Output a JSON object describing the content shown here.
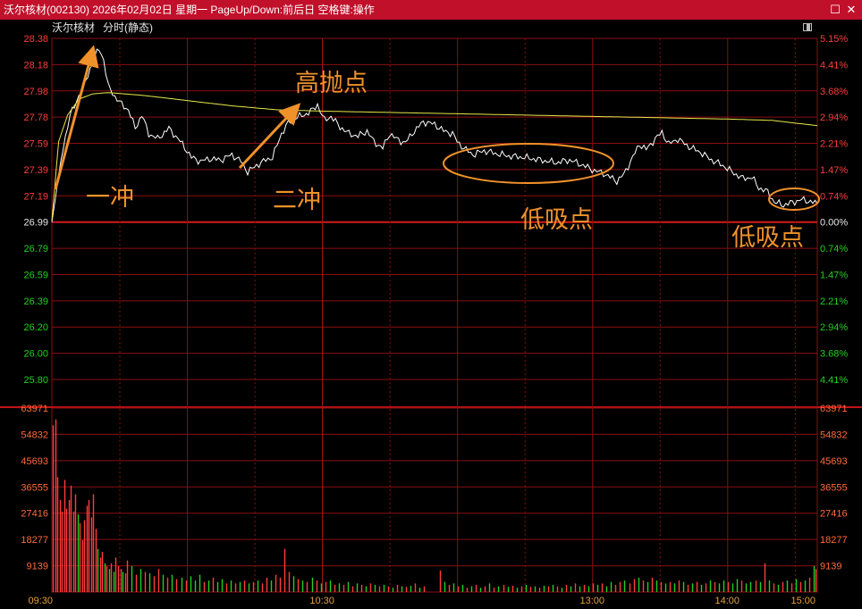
{
  "window": {
    "title": "沃尔核材(002130)  2026年02月02日  星期一  PageUp/Down:前后日  空格键:操作",
    "restore_icon": "restore-icon",
    "close_icon": "close-icon"
  },
  "header": {
    "stock_name": "沃尔核材",
    "chart_mode": "分时(静态)"
  },
  "colors": {
    "up": "#ff3c3c",
    "down": "#20d020",
    "grid": "#8b0f0f",
    "price_line": "#ffffff",
    "avg_line": "#e8e84a",
    "annotation": "#f0922a"
  },
  "annotations": [
    "一冲",
    "二冲",
    "高抛点",
    "低吸点",
    "低吸点"
  ],
  "chart_data": {
    "type": "line",
    "title": "沃尔核材 分时(静态)",
    "prev_close": 26.99,
    "price_ticks": [
      "28.38",
      "28.18",
      "27.98",
      "27.78",
      "27.59",
      "27.39",
      "27.19",
      "26.99",
      "26.79",
      "26.59",
      "26.39",
      "26.20",
      "26.00",
      "25.80"
    ],
    "pct_ticks": [
      "5.15%",
      "4.41%",
      "3.68%",
      "2.94%",
      "2.21%",
      "1.47%",
      "0.74%",
      "0.00%",
      "0.74%",
      "1.47%",
      "2.21%",
      "2.94%",
      "3.68%",
      "4.41%"
    ],
    "volume_ticks": [
      "63971",
      "54832",
      "45693",
      "36555",
      "27416",
      "18277",
      "9139"
    ],
    "time_ticks": [
      "09:30",
      "10:30",
      "13:00",
      "14:00",
      "15:00"
    ],
    "ylim": [
      25.8,
      28.38
    ],
    "volume_max": 63971,
    "price_keypoints": [
      [
        0,
        26.99
      ],
      [
        2,
        27.22
      ],
      [
        5,
        27.55
      ],
      [
        8,
        27.8
      ],
      [
        10,
        27.86
      ],
      [
        12,
        27.95
      ],
      [
        15,
        28.05
      ],
      [
        17,
        28.15
      ],
      [
        19,
        28.24
      ],
      [
        21,
        28.3
      ],
      [
        23,
        28.22
      ],
      [
        25,
        28.02
      ],
      [
        28,
        27.94
      ],
      [
        31,
        27.88
      ],
      [
        34,
        27.84
      ],
      [
        37,
        27.7
      ],
      [
        40,
        27.8
      ],
      [
        43,
        27.66
      ],
      [
        47,
        27.62
      ],
      [
        52,
        27.7
      ],
      [
        55,
        27.64
      ],
      [
        58,
        27.58
      ],
      [
        62,
        27.48
      ],
      [
        66,
        27.45
      ],
      [
        70,
        27.47
      ],
      [
        75,
        27.46
      ],
      [
        80,
        27.5
      ],
      [
        84,
        27.45
      ],
      [
        87,
        27.37
      ],
      [
        91,
        27.42
      ],
      [
        95,
        27.46
      ],
      [
        98,
        27.48
      ],
      [
        102,
        27.66
      ],
      [
        105,
        27.74
      ],
      [
        108,
        27.78
      ],
      [
        112,
        27.8
      ],
      [
        116,
        27.84
      ],
      [
        118,
        27.88
      ],
      [
        121,
        27.76
      ],
      [
        124,
        27.79
      ],
      [
        128,
        27.71
      ],
      [
        132,
        27.66
      ],
      [
        136,
        27.64
      ],
      [
        140,
        27.68
      ],
      [
        143,
        27.6
      ],
      [
        147,
        27.55
      ],
      [
        150,
        27.66
      ],
      [
        153,
        27.62
      ],
      [
        157,
        27.59
      ],
      [
        160,
        27.66
      ],
      [
        165,
        27.75
      ],
      [
        170,
        27.73
      ],
      [
        174,
        27.68
      ],
      [
        178,
        27.66
      ],
      [
        180,
        27.6
      ],
      [
        183,
        27.55
      ],
      [
        187,
        27.5
      ],
      [
        192,
        27.53
      ],
      [
        197,
        27.51
      ],
      [
        203,
        27.49
      ],
      [
        210,
        27.48
      ],
      [
        217,
        27.46
      ],
      [
        224,
        27.44
      ],
      [
        230,
        27.46
      ],
      [
        236,
        27.42
      ],
      [
        241,
        27.38
      ],
      [
        245,
        27.36
      ],
      [
        248,
        27.33
      ],
      [
        251,
        27.3
      ],
      [
        254,
        27.35
      ],
      [
        258,
        27.48
      ],
      [
        261,
        27.58
      ],
      [
        264,
        27.54
      ],
      [
        268,
        27.62
      ],
      [
        271,
        27.67
      ],
      [
        274,
        27.58
      ],
      [
        278,
        27.62
      ],
      [
        283,
        27.56
      ],
      [
        288,
        27.52
      ],
      [
        293,
        27.46
      ],
      [
        298,
        27.42
      ],
      [
        303,
        27.36
      ],
      [
        307,
        27.32
      ],
      [
        311,
        27.33
      ],
      [
        314,
        27.25
      ],
      [
        318,
        27.22
      ],
      [
        321,
        27.14
      ],
      [
        325,
        27.12
      ],
      [
        329,
        27.14
      ],
      [
        333,
        27.16
      ],
      [
        336,
        27.15
      ],
      [
        340,
        27.13
      ]
    ],
    "avg_keypoints": [
      [
        0,
        27.0
      ],
      [
        3,
        27.6
      ],
      [
        7,
        27.8
      ],
      [
        12,
        27.92
      ],
      [
        18,
        27.96
      ],
      [
        25,
        27.97
      ],
      [
        40,
        27.95
      ],
      [
        60,
        27.91
      ],
      [
        80,
        27.87
      ],
      [
        100,
        27.84
      ],
      [
        120,
        27.83
      ],
      [
        150,
        27.82
      ],
      [
        180,
        27.81
      ],
      [
        210,
        27.8
      ],
      [
        240,
        27.79
      ],
      [
        270,
        27.78
      ],
      [
        300,
        27.77
      ],
      [
        320,
        27.76
      ],
      [
        340,
        27.72
      ]
    ],
    "volume_bars": [
      [
        0,
        58000,
        "up"
      ],
      [
        1,
        60000,
        "up"
      ],
      [
        2,
        40000,
        "up"
      ],
      [
        3,
        32000,
        "up"
      ],
      [
        4,
        28000,
        "up"
      ],
      [
        5,
        39000,
        "up"
      ],
      [
        6,
        29000,
        "up"
      ],
      [
        7,
        32000,
        "up"
      ],
      [
        8,
        37000,
        "up"
      ],
      [
        9,
        28000,
        "up"
      ],
      [
        10,
        34000,
        "up"
      ],
      [
        11,
        27000,
        "down"
      ],
      [
        12,
        24000,
        "up"
      ],
      [
        13,
        18000,
        "up"
      ],
      [
        14,
        25000,
        "up"
      ],
      [
        15,
        30000,
        "up"
      ],
      [
        16,
        32000,
        "up"
      ],
      [
        17,
        26000,
        "up"
      ],
      [
        18,
        34000,
        "up"
      ],
      [
        19,
        22000,
        "up"
      ],
      [
        20,
        15000,
        "down"
      ],
      [
        21,
        12000,
        "up"
      ],
      [
        22,
        14000,
        "up"
      ],
      [
        23,
        10000,
        "down"
      ],
      [
        24,
        9000,
        "up"
      ],
      [
        25,
        8000,
        "down"
      ],
      [
        26,
        10000,
        "up"
      ],
      [
        27,
        7000,
        "down"
      ],
      [
        28,
        12000,
        "up"
      ],
      [
        29,
        9000,
        "up"
      ],
      [
        30,
        8000,
        "up"
      ],
      [
        31,
        7000,
        "down"
      ],
      [
        32,
        6500,
        "up"
      ],
      [
        33,
        11000,
        "up"
      ],
      [
        35,
        9000,
        "down"
      ],
      [
        37,
        6000,
        "up"
      ],
      [
        39,
        8000,
        "down"
      ],
      [
        41,
        7000,
        "up"
      ],
      [
        43,
        6500,
        "down"
      ],
      [
        45,
        5500,
        "up"
      ],
      [
        47,
        8000,
        "up"
      ],
      [
        49,
        6000,
        "down"
      ],
      [
        51,
        5000,
        "up"
      ],
      [
        53,
        6000,
        "down"
      ],
      [
        55,
        4500,
        "up"
      ],
      [
        57,
        5000,
        "down"
      ],
      [
        59,
        4000,
        "up"
      ],
      [
        61,
        5500,
        "down"
      ],
      [
        63,
        4000,
        "down"
      ],
      [
        65,
        6000,
        "down"
      ],
      [
        67,
        3500,
        "up"
      ],
      [
        69,
        4000,
        "down"
      ],
      [
        71,
        5000,
        "up"
      ],
      [
        73,
        3500,
        "down"
      ],
      [
        75,
        4500,
        "down"
      ],
      [
        77,
        3000,
        "up"
      ],
      [
        79,
        4000,
        "down"
      ],
      [
        81,
        3000,
        "up"
      ],
      [
        83,
        3500,
        "down"
      ],
      [
        85,
        4000,
        "up"
      ],
      [
        87,
        3000,
        "down"
      ],
      [
        89,
        3500,
        "up"
      ],
      [
        91,
        4000,
        "down"
      ],
      [
        93,
        3000,
        "up"
      ],
      [
        95,
        5000,
        "up"
      ],
      [
        97,
        4000,
        "down"
      ],
      [
        99,
        6000,
        "up"
      ],
      [
        101,
        5000,
        "up"
      ],
      [
        103,
        15000,
        "up"
      ],
      [
        105,
        7000,
        "up"
      ],
      [
        107,
        5500,
        "down"
      ],
      [
        109,
        4500,
        "up"
      ],
      [
        111,
        4000,
        "down"
      ],
      [
        113,
        3500,
        "up"
      ],
      [
        115,
        5000,
        "down"
      ],
      [
        117,
        4000,
        "up"
      ],
      [
        119,
        3000,
        "down"
      ],
      [
        121,
        3500,
        "up"
      ],
      [
        123,
        4000,
        "down"
      ],
      [
        125,
        2500,
        "up"
      ],
      [
        127,
        3000,
        "down"
      ],
      [
        129,
        2500,
        "up"
      ],
      [
        131,
        3500,
        "down"
      ],
      [
        133,
        2000,
        "up"
      ],
      [
        135,
        3000,
        "down"
      ],
      [
        137,
        2500,
        "up"
      ],
      [
        139,
        2000,
        "down"
      ],
      [
        141,
        3000,
        "up"
      ],
      [
        143,
        2500,
        "down"
      ],
      [
        145,
        2000,
        "up"
      ],
      [
        147,
        2500,
        "down"
      ],
      [
        149,
        2000,
        "up"
      ],
      [
        151,
        1500,
        "down"
      ],
      [
        153,
        2500,
        "up"
      ],
      [
        155,
        2000,
        "down"
      ],
      [
        157,
        1800,
        "up"
      ],
      [
        159,
        2200,
        "down"
      ],
      [
        161,
        3000,
        "up"
      ],
      [
        163,
        1500,
        "down"
      ],
      [
        165,
        2000,
        "up"
      ],
      [
        172,
        7500,
        "up"
      ],
      [
        174,
        3500,
        "down"
      ],
      [
        176,
        2500,
        "up"
      ],
      [
        178,
        3000,
        "down"
      ],
      [
        180,
        2000,
        "up"
      ],
      [
        182,
        2500,
        "down"
      ],
      [
        184,
        1500,
        "up"
      ],
      [
        186,
        2000,
        "down"
      ],
      [
        188,
        2500,
        "up"
      ],
      [
        190,
        1500,
        "down"
      ],
      [
        192,
        2000,
        "up"
      ],
      [
        194,
        3000,
        "down"
      ],
      [
        196,
        1500,
        "up"
      ],
      [
        198,
        2000,
        "down"
      ],
      [
        200,
        2500,
        "up"
      ],
      [
        202,
        1800,
        "down"
      ],
      [
        204,
        2200,
        "up"
      ],
      [
        206,
        1500,
        "down"
      ],
      [
        208,
        2000,
        "up"
      ],
      [
        210,
        2500,
        "down"
      ],
      [
        212,
        1800,
        "up"
      ],
      [
        214,
        2000,
        "down"
      ],
      [
        216,
        1500,
        "up"
      ],
      [
        218,
        2200,
        "down"
      ],
      [
        220,
        2000,
        "up"
      ],
      [
        222,
        2500,
        "down"
      ],
      [
        224,
        2000,
        "up"
      ],
      [
        226,
        1500,
        "down"
      ],
      [
        228,
        2500,
        "up"
      ],
      [
        230,
        2000,
        "down"
      ],
      [
        232,
        3000,
        "up"
      ],
      [
        234,
        2000,
        "down"
      ],
      [
        236,
        2500,
        "up"
      ],
      [
        238,
        2000,
        "down"
      ],
      [
        240,
        3000,
        "up"
      ],
      [
        242,
        2500,
        "down"
      ],
      [
        244,
        3000,
        "up"
      ],
      [
        246,
        2000,
        "down"
      ],
      [
        248,
        3500,
        "down"
      ],
      [
        250,
        2500,
        "up"
      ],
      [
        252,
        3500,
        "up"
      ],
      [
        254,
        4000,
        "down"
      ],
      [
        256,
        3000,
        "up"
      ],
      [
        258,
        4500,
        "up"
      ],
      [
        260,
        5000,
        "down"
      ],
      [
        262,
        4000,
        "up"
      ],
      [
        264,
        3500,
        "down"
      ],
      [
        266,
        5000,
        "up"
      ],
      [
        268,
        4000,
        "down"
      ],
      [
        270,
        3500,
        "up"
      ],
      [
        272,
        3000,
        "down"
      ],
      [
        274,
        3500,
        "up"
      ],
      [
        276,
        3000,
        "down"
      ],
      [
        278,
        4000,
        "up"
      ],
      [
        280,
        3500,
        "down"
      ],
      [
        282,
        2500,
        "up"
      ],
      [
        284,
        3000,
        "down"
      ],
      [
        286,
        3500,
        "up"
      ],
      [
        288,
        2500,
        "down"
      ],
      [
        290,
        3000,
        "up"
      ],
      [
        292,
        4000,
        "down"
      ],
      [
        294,
        3500,
        "up"
      ],
      [
        296,
        3000,
        "down"
      ],
      [
        298,
        4000,
        "down"
      ],
      [
        300,
        3500,
        "up"
      ],
      [
        302,
        3000,
        "down"
      ],
      [
        304,
        4500,
        "down"
      ],
      [
        306,
        4000,
        "up"
      ],
      [
        308,
        3000,
        "down"
      ],
      [
        310,
        3500,
        "down"
      ],
      [
        312,
        4000,
        "up"
      ],
      [
        314,
        3500,
        "down"
      ],
      [
        316,
        10000,
        "up"
      ],
      [
        318,
        4000,
        "down"
      ],
      [
        320,
        3000,
        "up"
      ],
      [
        322,
        2500,
        "down"
      ],
      [
        324,
        3500,
        "up"
      ],
      [
        326,
        4000,
        "down"
      ],
      [
        328,
        3000,
        "up"
      ],
      [
        330,
        4500,
        "down"
      ],
      [
        332,
        3500,
        "up"
      ],
      [
        334,
        4000,
        "down"
      ],
      [
        336,
        5000,
        "up"
      ],
      [
        338,
        9000,
        "down"
      ],
      [
        339,
        8000,
        "up"
      ]
    ]
  }
}
